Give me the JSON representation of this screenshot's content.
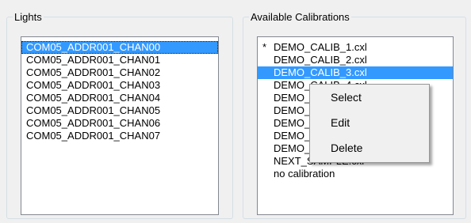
{
  "lights_group": {
    "title": "Lights",
    "items": [
      "COM05_ADDR001_CHAN00",
      "COM05_ADDR001_CHAN01",
      "COM05_ADDR001_CHAN02",
      "COM05_ADDR001_CHAN03",
      "COM05_ADDR001_CHAN04",
      "COM05_ADDR001_CHAN05",
      "COM05_ADDR001_CHAN06",
      "COM05_ADDR001_CHAN07"
    ],
    "selected_index": 0
  },
  "calibrations_group": {
    "title": "Available Calibrations",
    "items": [
      {
        "marker": "*",
        "label": "DEMO_CALIB_1.cxl"
      },
      {
        "marker": "",
        "label": "DEMO_CALIB_2.cxl"
      },
      {
        "marker": "",
        "label": "DEMO_CALIB_3.cxl"
      },
      {
        "marker": "",
        "label": "DEMO_CALIB_4.cxl"
      },
      {
        "marker": "",
        "label": "DEMO_CALIB_5.cxl"
      },
      {
        "marker": "",
        "label": "DEMO_CALIB_6.cxl"
      },
      {
        "marker": "",
        "label": "DEMO_CALIB_7.cxl"
      },
      {
        "marker": "",
        "label": "DEMO_CALIB_8.cxl"
      },
      {
        "marker": "",
        "label": "DEMO_CALIB_9.cxl"
      },
      {
        "marker": "",
        "label": "NEXT_SAMPLE.cxl"
      },
      {
        "marker": "",
        "label": "no calibration"
      }
    ],
    "selected_index": 2
  },
  "context_menu": {
    "select_label": "Select",
    "edit_label": "Edit",
    "delete_label": "Delete"
  },
  "colors": {
    "selection": "#3399ff",
    "window_background": "#f0f0f0"
  }
}
